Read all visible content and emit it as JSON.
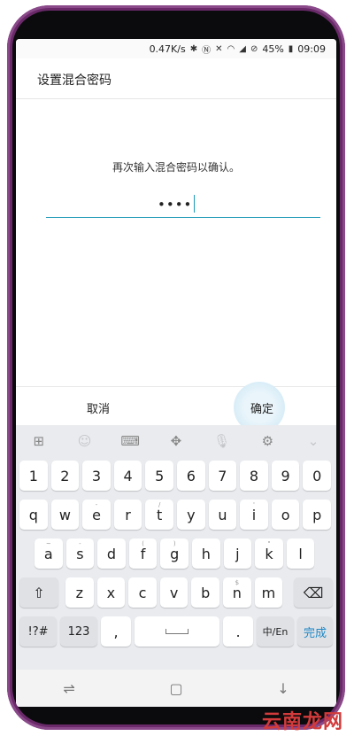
{
  "status_bar": {
    "speed": "0.47K/s",
    "battery": "45%",
    "time": "09:09",
    "icons": [
      "bluetooth-icon",
      "nfc-icon",
      "mute-icon",
      "wifi-icon",
      "signal-icon",
      "block-icon",
      "battery-icon"
    ]
  },
  "header": {
    "title": "设置混合密码"
  },
  "dialog": {
    "prompt": "再次输入混合密码以确认。",
    "password_mask": "••••",
    "cancel_label": "取消",
    "ok_label": "确定"
  },
  "keyboard": {
    "toolbar": [
      "grid-icon",
      "emoji-icon",
      "keyboard-icon",
      "move-icon",
      "mic-icon",
      "gear-icon",
      "chevron-down-icon"
    ],
    "row_numbers": [
      "1",
      "2",
      "3",
      "4",
      "5",
      "6",
      "7",
      "8",
      "9",
      "0"
    ],
    "row_q": [
      {
        "k": "q",
        "h": ""
      },
      {
        "k": "w",
        "h": ""
      },
      {
        "k": "e",
        "h": "-"
      },
      {
        "k": "r",
        "h": ""
      },
      {
        "k": "t",
        "h": "/"
      },
      {
        "k": "y",
        "h": ""
      },
      {
        "k": "u",
        "h": ""
      },
      {
        "k": "i",
        "h": "'"
      },
      {
        "k": "o",
        "h": ""
      },
      {
        "k": "p",
        "h": ""
      }
    ],
    "row_a": [
      {
        "k": "a",
        "h": "~"
      },
      {
        "k": "s",
        "h": "-"
      },
      {
        "k": "d",
        "h": ""
      },
      {
        "k": "f",
        "h": "("
      },
      {
        "k": "g",
        "h": ")"
      },
      {
        "k": "h",
        "h": ""
      },
      {
        "k": "j",
        "h": ""
      },
      {
        "k": "k",
        "h": "\""
      },
      {
        "k": "l",
        "h": ""
      }
    ],
    "row_z": [
      {
        "k": "z",
        "h": ""
      },
      {
        "k": "x",
        "h": ""
      },
      {
        "k": "c",
        "h": ""
      },
      {
        "k": "v",
        "h": ""
      },
      {
        "k": "b",
        "h": ""
      },
      {
        "k": "n",
        "h": "$"
      },
      {
        "k": "m",
        "h": ""
      }
    ],
    "shift_icon": "shift-icon",
    "backspace_icon": "backspace-icon",
    "symbols_label": "!?#",
    "numbers_label": "123",
    "comma_label": ",",
    "period_label": ".",
    "lang_label": "中/En",
    "done_label": "完成"
  },
  "navbar": [
    "recent-apps-icon",
    "home-icon",
    "back-icon"
  ],
  "watermark": "云南龙网"
}
